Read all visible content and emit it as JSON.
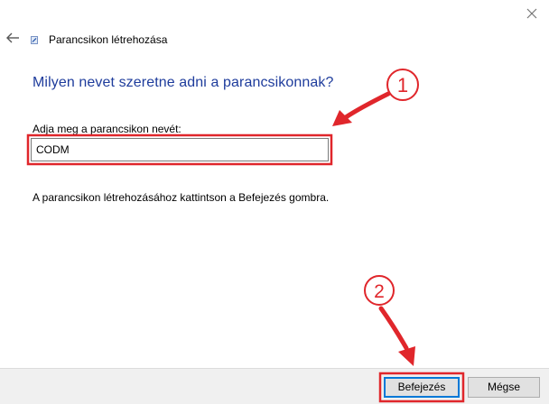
{
  "wizard": {
    "title": "Parancsikon létrehozása",
    "heading": "Milyen nevet szeretne adni a parancsikonnak?",
    "field_label": "Adja meg a parancsikon nevét:",
    "field_value": "CODM",
    "hint": "A parancsikon létrehozásához kattintson a Befejezés gombra."
  },
  "buttons": {
    "finish": "Befejezés",
    "cancel": "Mégse"
  },
  "annotations": {
    "step1": "1",
    "step2": "2",
    "color": "#e0262b"
  },
  "icons": [
    "close-icon",
    "back-arrow-icon",
    "shortcut-wizard-icon"
  ],
  "colors": {
    "heading": "#1e3c9c",
    "focus_border": "#0078d7",
    "footer_bg": "#f0f0f0"
  }
}
